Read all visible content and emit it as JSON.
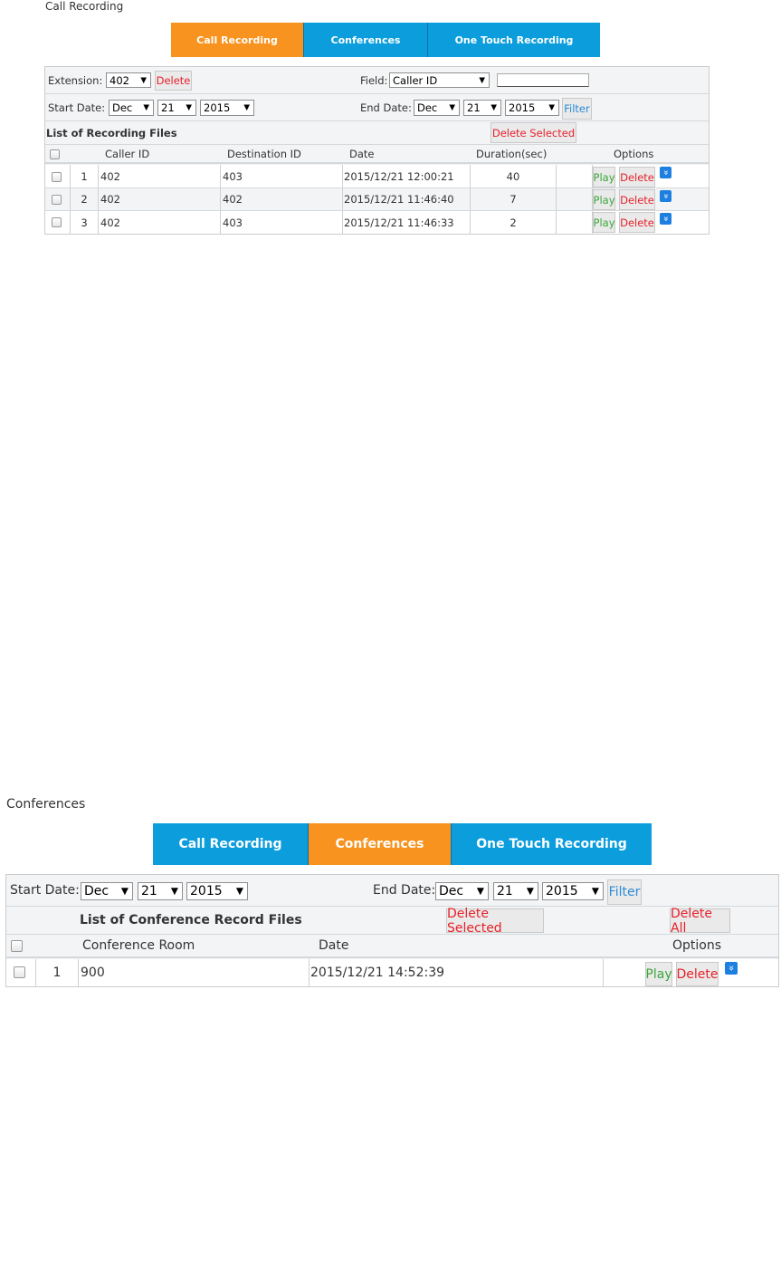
{
  "top": {
    "title": "Call Recording",
    "tabs": [
      "Call Recording",
      "Conferences",
      "One Touch Recording"
    ],
    "filter": {
      "extension_label": "Extension:",
      "extension_value": "402",
      "delete_label": "Delete",
      "field_label": "Field:",
      "field_value": "Caller ID",
      "field_input": "",
      "start_label": "Start Date:",
      "start": [
        "Dec",
        "21",
        "2015"
      ],
      "end_label": "End Date:",
      "end": [
        "Dec",
        "21",
        "2015"
      ],
      "filter_label": "Filter"
    },
    "list_title": "List of Recording Files",
    "delete_selected": "Delete Selected",
    "columns": [
      "Caller ID",
      "Destination ID",
      "Date",
      "Duration(sec)",
      "Options"
    ],
    "rows": [
      {
        "num": "1",
        "caller": "402",
        "dest": "403",
        "date": "2015/12/21 12:00:21",
        "duration": "40"
      },
      {
        "num": "2",
        "caller": "402",
        "dest": "402",
        "date": "2015/12/21 11:46:40",
        "duration": "7"
      },
      {
        "num": "3",
        "caller": "402",
        "dest": "403",
        "date": "2015/12/21 11:46:33",
        "duration": "2"
      }
    ],
    "play": "Play",
    "delete": "Delete"
  },
  "bottom": {
    "title": "Conferences",
    "tabs": [
      "Call Recording",
      "Conferences",
      "One Touch Recording"
    ],
    "filter": {
      "start_label": "Start Date:",
      "start": [
        "Dec",
        "21",
        "2015"
      ],
      "end_label": "End Date:",
      "end": [
        "Dec",
        "21",
        "2015"
      ],
      "filter_label": "Filter"
    },
    "list_title": "List of Conference Record Files",
    "delete_selected": "Delete Selected",
    "delete_all": "Delete All",
    "columns": [
      "Conference Room",
      "Date",
      "Options"
    ],
    "rows": [
      {
        "num": "1",
        "room": "900",
        "date": "2015/12/21 14:52:39"
      }
    ],
    "play": "Play",
    "delete": "Delete"
  },
  "colors": {
    "active_tab": "#f7931e",
    "tab": "#0b9ddc",
    "delete_text": "#e8202a",
    "play_text": "#3aa63a",
    "filter_text": "#2a8bd6",
    "download_icon": "#1d7fe0"
  },
  "icons": {
    "download": "double-chevron-down-icon",
    "select_arrow": "triangle-down"
  }
}
